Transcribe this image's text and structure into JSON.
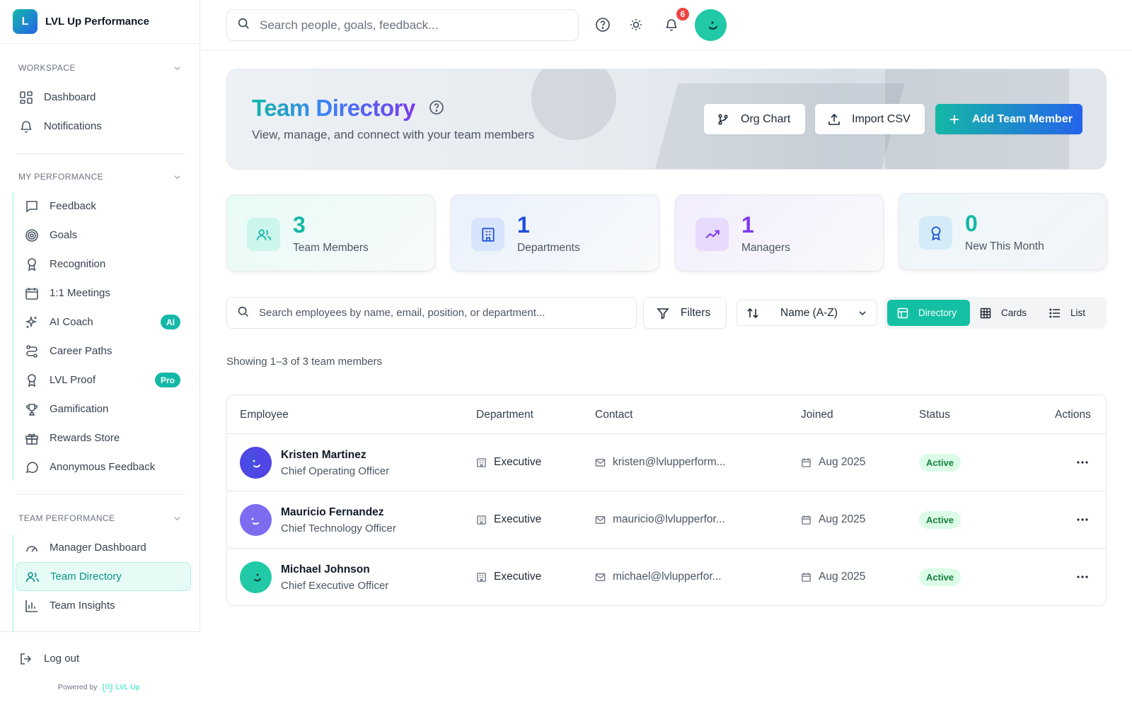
{
  "brand": {
    "logo_letter": "L",
    "name": "LVL Up Performance"
  },
  "sidebar": {
    "workspace": {
      "title": "WORKSPACE",
      "items": [
        {
          "label": "Dashboard",
          "icon": "dashboard-icon"
        },
        {
          "label": "Notifications",
          "icon": "bell-icon"
        }
      ]
    },
    "my_performance": {
      "title": "MY PERFORMANCE",
      "items": [
        {
          "label": "Feedback",
          "icon": "message-square-icon"
        },
        {
          "label": "Goals",
          "icon": "target-icon"
        },
        {
          "label": "Recognition",
          "icon": "award-icon"
        },
        {
          "label": "1:1 Meetings",
          "icon": "calendar-icon"
        },
        {
          "label": "AI Coach",
          "icon": "sparkles-icon",
          "badge": "AI"
        },
        {
          "label": "Career Paths",
          "icon": "route-icon"
        },
        {
          "label": "LVL Proof",
          "icon": "award-icon",
          "badge": "Pro"
        },
        {
          "label": "Gamification",
          "icon": "trophy-icon"
        },
        {
          "label": "Rewards Store",
          "icon": "gift-icon"
        },
        {
          "label": "Anonymous Feedback",
          "icon": "message-circle-icon"
        }
      ]
    },
    "team_performance": {
      "title": "TEAM PERFORMANCE",
      "items": [
        {
          "label": "Manager Dashboard",
          "icon": "gauge-icon"
        },
        {
          "label": "Team Directory",
          "icon": "users-icon",
          "active": true
        },
        {
          "label": "Team Insights",
          "icon": "bar-chart-icon"
        }
      ]
    },
    "logout_label": "Log out",
    "powered_by": "Powered by",
    "powered_brand": "LVL Up"
  },
  "topbar": {
    "search_placeholder": "Search people, goals, feedback...",
    "notification_count": "6"
  },
  "hero": {
    "title": "Team Directory",
    "subtitle": "View, manage, and connect with your team members",
    "org_chart_label": "Org Chart",
    "import_label": "Import CSV",
    "add_label": "Add Team Member"
  },
  "stats": [
    {
      "value": "3",
      "label": "Team Members",
      "color": "#14b8a6"
    },
    {
      "value": "1",
      "label": "Departments",
      "color": "#1d4ed8"
    },
    {
      "value": "1",
      "label": "Managers",
      "color": "#7c3aed"
    },
    {
      "value": "0",
      "label": "New This Month",
      "color": "#14b8a6"
    }
  ],
  "toolbar": {
    "search_placeholder": "Search employees by name, email, position, or department...",
    "filters_label": "Filters",
    "sort_value": "Name (A-Z)",
    "views": [
      "Directory",
      "Cards",
      "List"
    ],
    "active_view": "Directory"
  },
  "showing_text": "Showing 1–3 of 3 team members",
  "table": {
    "columns": [
      "Employee",
      "Department",
      "Contact",
      "Joined",
      "Status",
      "Actions"
    ],
    "rows": [
      {
        "name": "Kristen Martinez",
        "position": "Chief Operating Officer",
        "department": "Executive",
        "contact": "kristen@lvlupperform...",
        "joined": "Aug 2025",
        "status": "Active",
        "avatar_color": "#4f46e5"
      },
      {
        "name": "Mauricio Fernandez",
        "position": "Chief Technology Officer",
        "department": "Executive",
        "contact": "mauricio@lvlupperfor...",
        "joined": "Aug 2025",
        "status": "Active",
        "avatar_color": "#7c6cf0"
      },
      {
        "name": "Michael Johnson",
        "position": "Chief Executive Officer",
        "department": "Executive",
        "contact": "michael@lvlupperfor...",
        "joined": "Aug 2025",
        "status": "Active",
        "avatar_color": "#22c9a6"
      }
    ]
  }
}
